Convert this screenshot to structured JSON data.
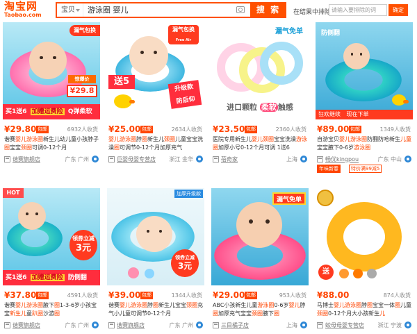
{
  "header": {
    "logo_cn": "淘宝网",
    "logo_en": "Taobao.com",
    "scope_label": "宝贝",
    "query": "游泳圈 婴儿",
    "search_button": "搜 索",
    "in_results_label": "在结果中排除",
    "in_results_placeholder": "请输入要排除的词",
    "in_results_button": "确定",
    "accent_color": "#ff5000"
  },
  "products": [
    {
      "price": "¥29.80",
      "free_shipping": "包邮",
      "sales": "6932人收货",
      "title_parts": [
        "谐赛",
        "婴儿",
        "游泳",
        "圈",
        "新生儿幼儿童小孩脖子",
        "圈",
        "宝宝",
        "颈",
        "圈",
        "可调0-12个月"
      ],
      "shop": "谐赛旗舰店",
      "location": "广东 广州",
      "thumb": {
        "badges": [
          "漏气包换",
          "惊爆价",
          "¥29.8",
          "买1送6",
          "加赠运费险",
          "Q弹柔软"
        ]
      }
    },
    {
      "price": "¥25.00",
      "free_shipping": "包邮",
      "sales": "2634人收货",
      "title_parts": [
        "婴儿",
        "游泳",
        "圈",
        "脖",
        "圈",
        "新生儿",
        "颈",
        "圈",
        "儿童宝宝洗澡",
        "圈",
        "可调节0-12个月加厚充气"
      ],
      "shop": "巨婴母婴专营店",
      "location": "浙江 金华",
      "thumb": {
        "badges": [
          "漏气包换",
          "Free Air Leakage",
          "送5",
          "升级款",
          "防后仰"
        ]
      }
    },
    {
      "price": "¥23.50",
      "free_shipping": "包邮",
      "sales": "2360人收货",
      "title_parts": [
        "医院",
        "专用新生儿",
        "婴儿",
        "颈",
        "圈",
        "宝宝洗澡",
        "游泳",
        "圈",
        "加厚小号0-12个月可调 1送6"
      ],
      "shop": "蓓奇家",
      "location": "上海",
      "thumb": {
        "badges": [
          "漏气免单",
          "进口颗粒",
          "柔软",
          "触感"
        ]
      }
    },
    {
      "price": "¥89.00",
      "free_shipping": "包邮",
      "sales": "1349人收货",
      "title_parts": [
        "自游宝贝",
        "婴儿",
        "游泳",
        "圈",
        "防翻防呛新生",
        "儿",
        "童",
        "宝宝",
        "腋下0-6岁",
        "游泳",
        "圈"
      ],
      "shop": "畅优kingpou",
      "location": "广东 中山",
      "thumb": {
        "badges": [
          "防侧翻",
          "狂欢继续",
          "现在下单"
        ]
      },
      "tags": [
        "年味新春",
        "特价满99减5"
      ]
    },
    {
      "price": "¥37.80",
      "free_shipping": "包邮",
      "sales": "4591人收货",
      "title_parts": [
        "谐赛",
        "婴儿",
        "游泳",
        "圈",
        "腋下",
        "圈",
        "1-3-6岁小孩宝宝",
        "新生儿",
        "童",
        "趴",
        "圈",
        "沙游",
        "圈"
      ],
      "shop": "谐赛旗舰店",
      "location": "广东 广州",
      "thumb": {
        "badges": [
          "HOT",
          "领券立减",
          "3元",
          "买1送6",
          "加赠运费险",
          "防侧翻"
        ]
      }
    },
    {
      "price": "¥39.00",
      "free_shipping": "包邮",
      "sales": "1344人收货",
      "title_parts": [
        "谐赛",
        "婴儿",
        "游泳",
        "圈",
        "脖",
        "圈",
        "新生儿",
        "宝宝",
        "颈",
        "圈",
        "充气小儿童可调节0-12个月"
      ],
      "shop": "谐赛旗舰店",
      "location": "广东 广州",
      "thumb": {
        "badges": [
          "加厚升级款",
          "领券立减",
          "3元"
        ]
      }
    },
    {
      "price": "¥29.00",
      "free_shipping": "包邮",
      "sales": "953人收货",
      "title_parts": [
        "ABC小孩新生儿童",
        "游泳",
        "圈",
        "0-6岁",
        "婴儿",
        "脖",
        "圈",
        "加厚充气宝宝",
        "颈",
        "圈",
        "腋下",
        "圈"
      ],
      "shop": "三目橘子店",
      "location": "上海",
      "thumb": {
        "badges": [
          "漏气免单"
        ]
      }
    },
    {
      "price": "¥88.00",
      "free_shipping": "",
      "sales": "874人收货",
      "title_parts": [
        "马博士",
        "婴儿",
        "游泳",
        "圈",
        "脖",
        "圈",
        "宝宝一体",
        "圈",
        "儿童",
        "颈",
        "圈",
        "0-12个月大小孩新生",
        "儿"
      ],
      "shop": "蛟母母婴专营店",
      "location": "浙江 宁波",
      "thumb": {
        "badges": [
          "送"
        ]
      }
    }
  ]
}
